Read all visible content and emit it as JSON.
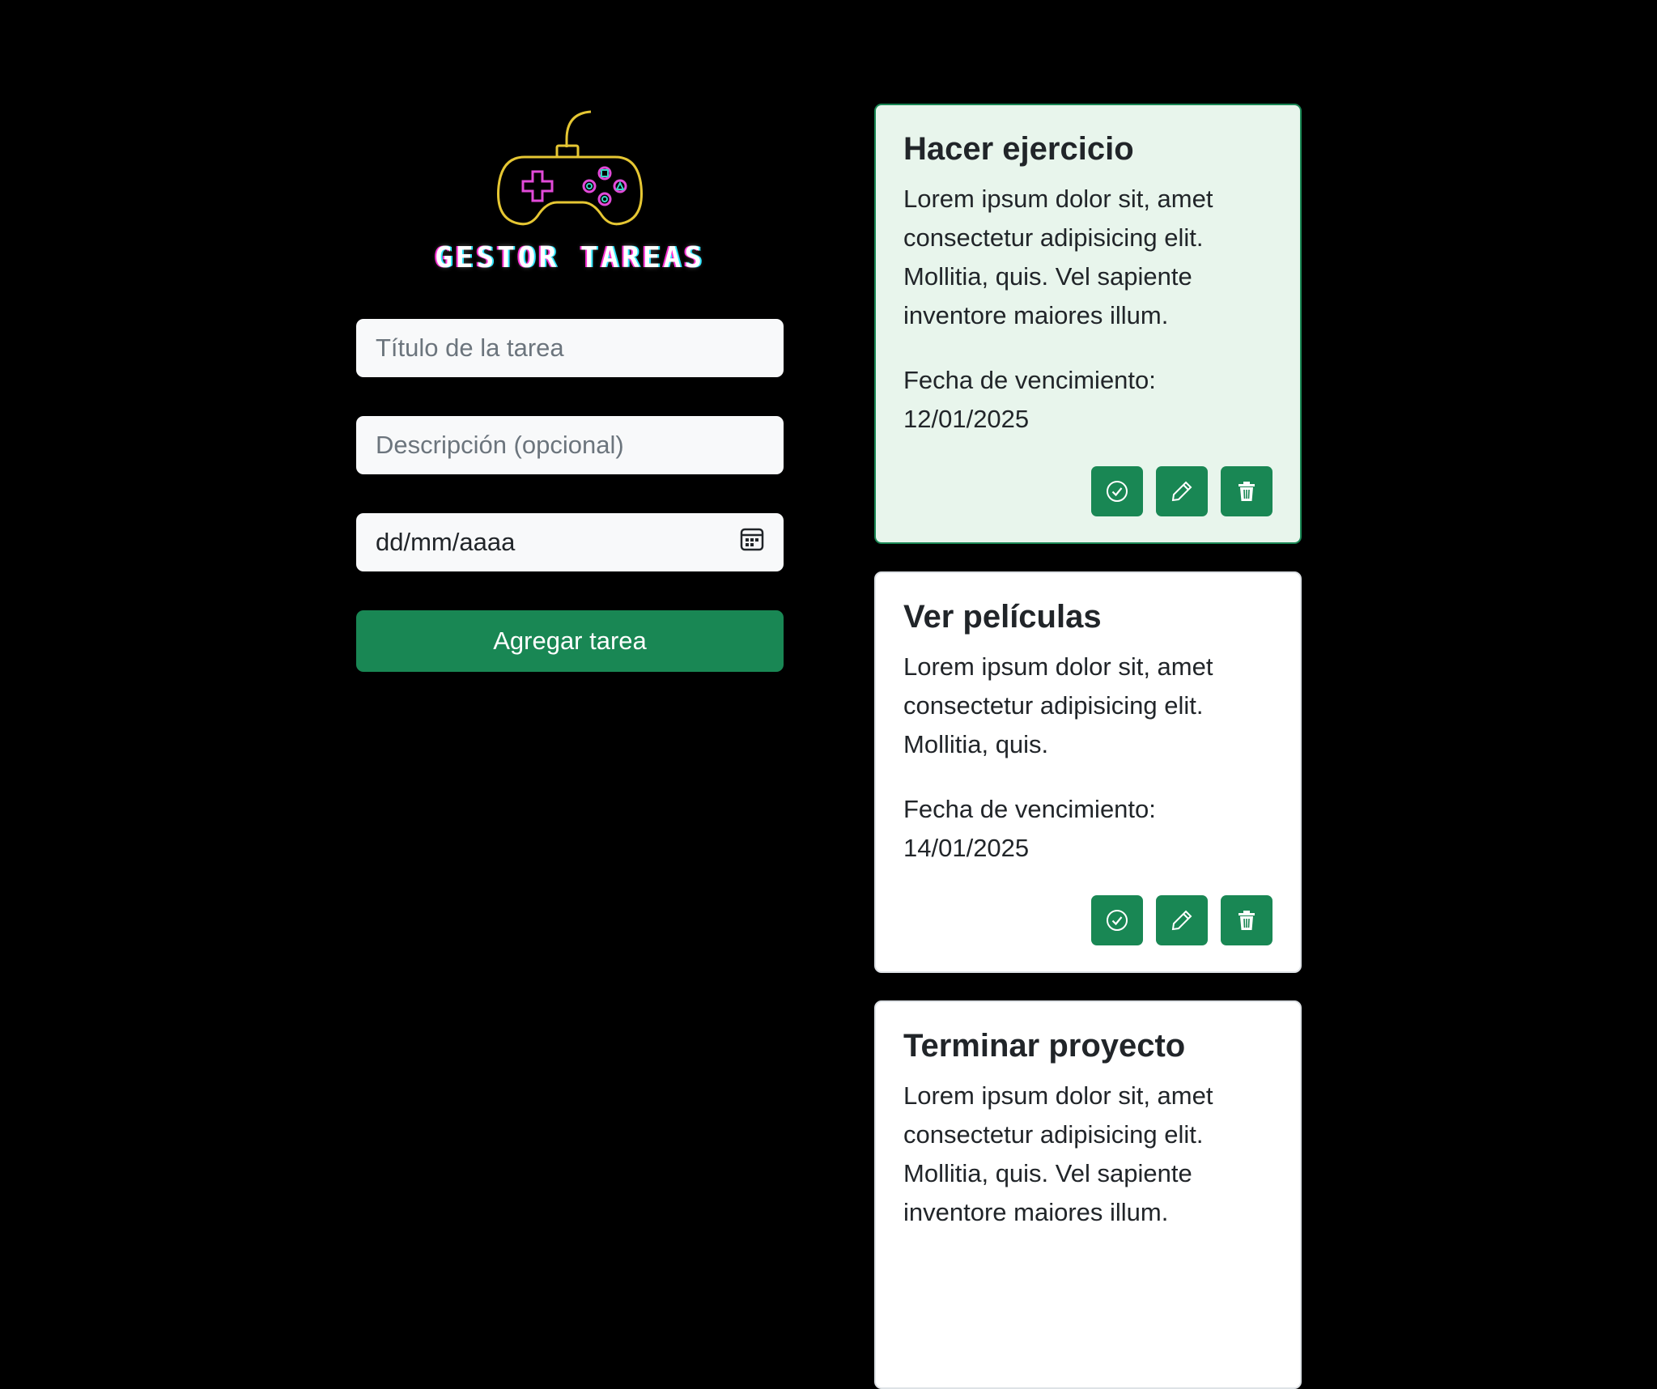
{
  "logo": {
    "text": "GESTOR TAREAS",
    "icon": "gamepad-icon"
  },
  "form": {
    "title_placeholder": "Título de la tarea",
    "description_placeholder": "Descripción (opcional)",
    "date_placeholder": "dd/mm/aaaa",
    "date_icon": "calendar-icon",
    "add_button_label": "Agregar tarea"
  },
  "tasks": [
    {
      "title": "Hacer ejercicio",
      "description": "Lorem ipsum dolor sit, amet consectetur adipisicing elit. Mollitia, quis. Vel sapiente inventore maiores illum.",
      "due_label": "Fecha de vencimiento:",
      "due_date": "12/01/2025",
      "completed": true
    },
    {
      "title": "Ver películas",
      "description": "Lorem ipsum dolor sit, amet consectetur adipisicing elit. Mollitia, quis.",
      "due_label": "Fecha de vencimiento:",
      "due_date": "14/01/2025",
      "completed": false
    },
    {
      "title": "Terminar proyecto",
      "description": "Lorem ipsum dolor sit, amet consectetur adipisicing elit. Mollitia, quis. Vel sapiente inventore maiores illum.",
      "completed": false
    }
  ],
  "actions": {
    "complete_icon": "check-circle-icon",
    "edit_icon": "pencil-icon",
    "delete_icon": "trash-icon"
  },
  "colors": {
    "background": "#000000",
    "accent": "#198754",
    "completed_card": "#e8f5ec",
    "field": "#f8f9fa"
  }
}
